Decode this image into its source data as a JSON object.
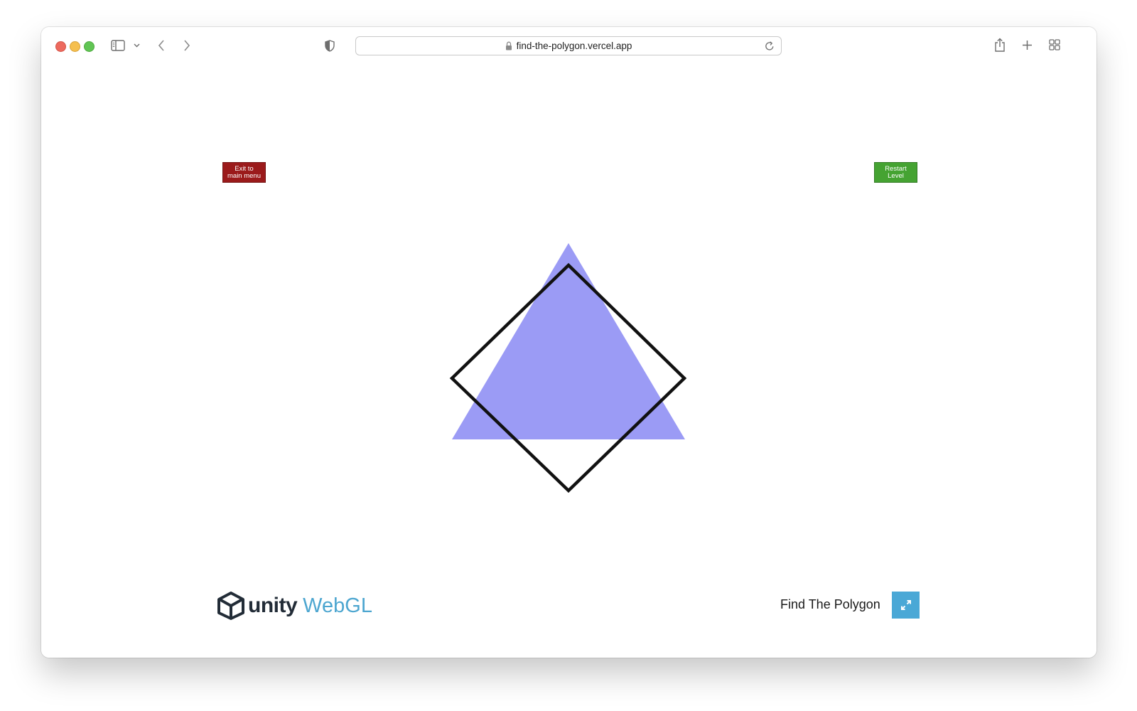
{
  "browser": {
    "url": "find-the-polygon.vercel.app",
    "icons": {
      "sidebar": "sidebar-icon",
      "chevron": "chevron-down-icon",
      "back": "back-arrow-icon",
      "forward": "forward-arrow-icon",
      "shield": "shield-icon",
      "lock": "lock-icon",
      "reload": "reload-icon",
      "share": "share-icon",
      "new_tab": "plus-icon",
      "tab_overview": "tab-grid-icon"
    }
  },
  "game": {
    "exit_button_label": "Exit to\nmain menu",
    "restart_button_label": "Restart\nLevel",
    "colors": {
      "exit": "#9b1a1b",
      "restart": "#45a332",
      "triangle_fill": "#9b9bf5",
      "square_stroke": "#111111"
    },
    "shapes": [
      "filled-triangle",
      "outlined-diamond"
    ]
  },
  "footer": {
    "logo_unity": "unity",
    "logo_webgl": "WebGL",
    "title": "Find The Polygon",
    "fullscreen_icon": "fullscreen-icon",
    "colors": {
      "fullscreen_bg": "#4aa8d6",
      "webgl_text": "#4da6d0"
    }
  }
}
